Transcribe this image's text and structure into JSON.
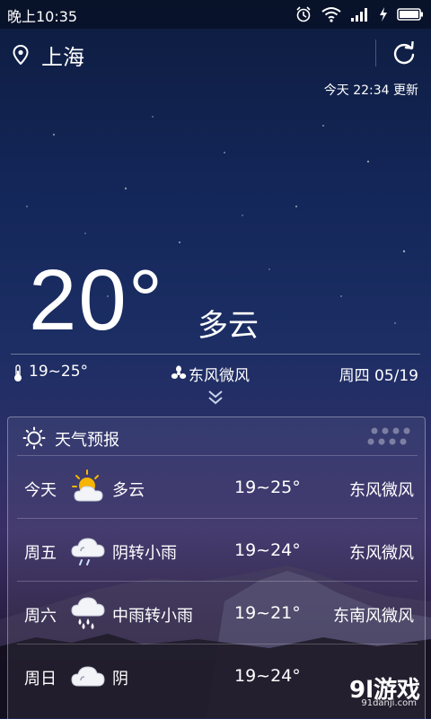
{
  "status_bar": {
    "time": "晚上10:35"
  },
  "header": {
    "city": "上海",
    "updated": "今天 22:34 更新"
  },
  "current": {
    "temp": "20°",
    "condition": "多云",
    "range": "19~25°",
    "wind": "东风微风",
    "date": "周四 05/19"
  },
  "forecast": {
    "title": "天气预报",
    "rows": [
      {
        "day": "今天",
        "icon": "partly-cloudy-icon",
        "condition": "多云",
        "range": "19~25°",
        "wind": "东风微风"
      },
      {
        "day": "周五",
        "icon": "cloud-rain-icon",
        "condition": "阴转小雨",
        "range": "19~24°",
        "wind": "东风微风"
      },
      {
        "day": "周六",
        "icon": "cloud-heavy-rain-icon",
        "condition": "中雨转小雨",
        "range": "19~21°",
        "wind": "东南风微风"
      },
      {
        "day": "周日",
        "icon": "cloud-icon",
        "condition": "阴",
        "range": "19~24°",
        "wind": ""
      }
    ]
  },
  "watermark": {
    "brand": "9l游戏",
    "url": "91danji.com"
  },
  "colors": {
    "sky_top": "#0d1c3f",
    "sky_mid": "#1c2e64",
    "sky_dusk": "#3a2f66",
    "text": "#ffffff"
  }
}
